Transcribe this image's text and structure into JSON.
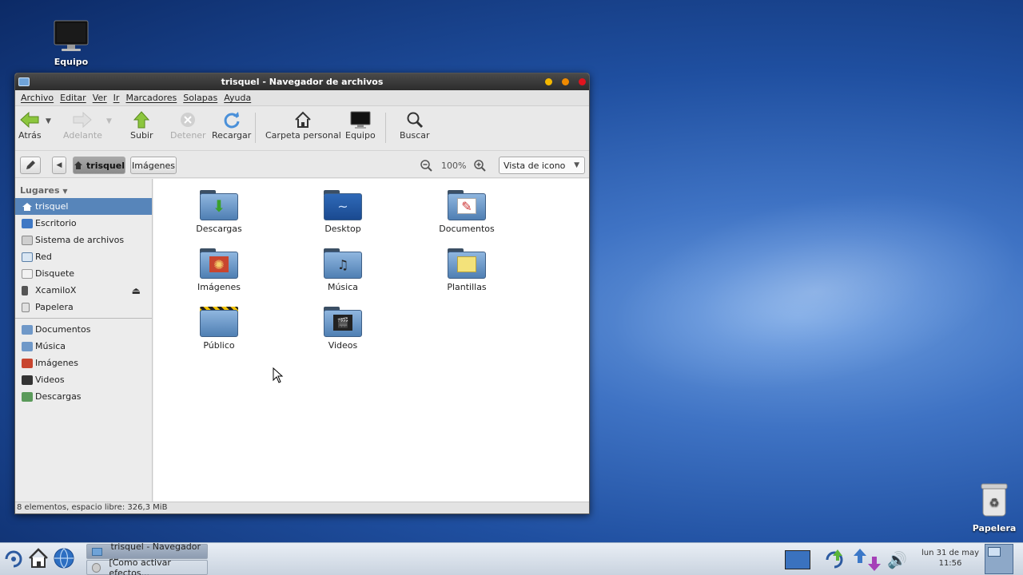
{
  "desktop": {
    "icons": [
      {
        "label": "Equipo"
      },
      {
        "label": "Papelera"
      }
    ]
  },
  "window": {
    "title": "trisquel - Navegador de archivos",
    "menu": [
      "Archivo",
      "Editar",
      "Ver",
      "Ir",
      "Marcadores",
      "Solapas",
      "Ayuda"
    ],
    "toolbar": {
      "back": "Atrás",
      "forward": "Adelante",
      "up": "Subir",
      "stop": "Detener",
      "reload": "Recargar",
      "home": "Carpeta personal",
      "computer": "Equipo",
      "search": "Buscar"
    },
    "pathbar": {
      "current": "trisquel",
      "next": "Imágenes",
      "zoom": "100%",
      "view": "Vista de icono"
    },
    "sidebar": {
      "header": "Lugares",
      "places": [
        "trisquel",
        "Escritorio",
        "Sistema de archivos",
        "Red",
        "Disquete",
        "XcamiloX",
        "Papelera"
      ],
      "bookmarks": [
        "Documentos",
        "Música",
        "Imágenes",
        "Videos",
        "Descargas"
      ]
    },
    "files": [
      "Descargas",
      "Desktop",
      "Documentos",
      "Imágenes",
      "Música",
      "Plantillas",
      "Público",
      "Videos"
    ],
    "status": "8 elementos, espacio libre: 326,3 MiB"
  },
  "taskbar": {
    "tasks": [
      "trisquel - Navegador ...",
      "[Como activar efectos..."
    ],
    "clock_date": "lun 31 de may",
    "clock_time": "11:56"
  },
  "colors": {
    "selection": "#5785ba",
    "titlebar": "#2c2c2c",
    "btn_min": "#f5b800",
    "btn_max": "#f08a00",
    "btn_close": "#e0141e"
  }
}
